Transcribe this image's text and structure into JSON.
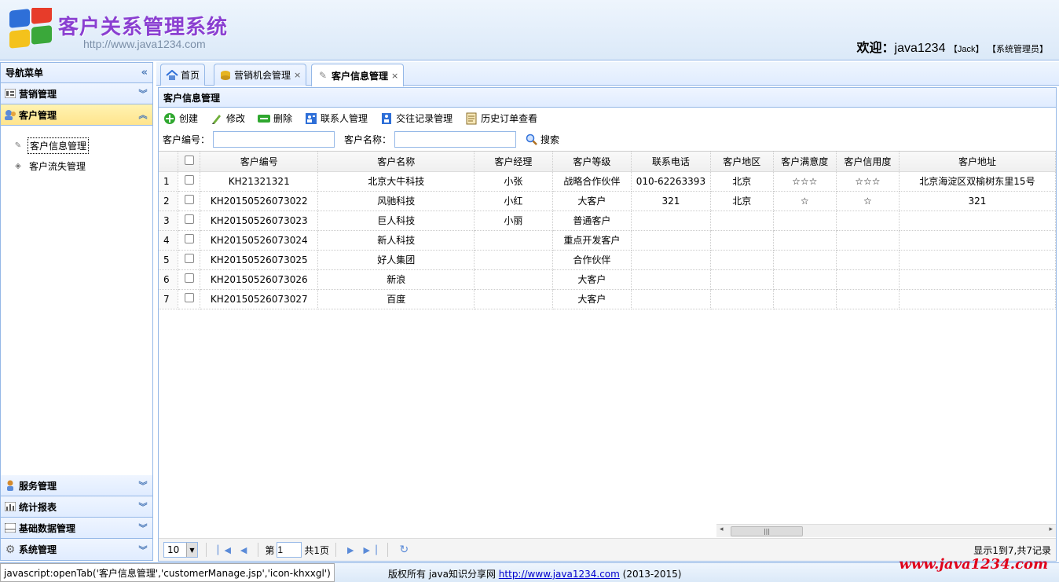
{
  "header": {
    "title": "客户关系管理系统",
    "url": "http://www.java1234.com",
    "welcome_label": "欢迎：",
    "username": "java1234",
    "nickname": "【Jack】",
    "role": "【系统管理员】"
  },
  "nav": {
    "title": "导航菜单",
    "items": [
      {
        "label": "营销管理"
      },
      {
        "label": "客户管理"
      },
      {
        "label": "服务管理"
      },
      {
        "label": "统计报表"
      },
      {
        "label": "基础数据管理"
      },
      {
        "label": "系统管理"
      }
    ],
    "sub_items": [
      {
        "label": "客户信息管理"
      },
      {
        "label": "客户流失管理"
      }
    ]
  },
  "tabs": [
    {
      "label": "首页"
    },
    {
      "label": "营销机会管理"
    },
    {
      "label": "客户信息管理"
    }
  ],
  "panel": {
    "title": "客户信息管理"
  },
  "toolbar": {
    "create": "创建",
    "edit": "修改",
    "delete": "删除",
    "contacts": "联系人管理",
    "records": "交往记录管理",
    "orders": "历史订单查看"
  },
  "search": {
    "code_label": "客户编号：",
    "name_label": "客户名称：",
    "button": "搜索"
  },
  "table": {
    "columns": [
      "客户编号",
      "客户名称",
      "客户经理",
      "客户等级",
      "联系电话",
      "客户地区",
      "客户满意度",
      "客户信用度",
      "客户地址"
    ],
    "rows": [
      [
        "1",
        "KH21321321",
        "北京大牛科技",
        "小张",
        "战略合作伙伴",
        "010-62263393",
        "北京",
        "☆☆☆",
        "☆☆☆",
        "北京海淀区双榆树东里15号"
      ],
      [
        "2",
        "KH20150526073022",
        "风驰科技",
        "小红",
        "大客户",
        "321",
        "北京",
        "☆",
        "☆",
        "321"
      ],
      [
        "3",
        "KH20150526073023",
        "巨人科技",
        "小丽",
        "普通客户",
        "",
        "",
        "",
        "",
        ""
      ],
      [
        "4",
        "KH20150526073024",
        "新人科技",
        "",
        "重点开发客户",
        "",
        "",
        "",
        "",
        ""
      ],
      [
        "5",
        "KH20150526073025",
        "好人集团",
        "",
        "合作伙伴",
        "",
        "",
        "",
        "",
        ""
      ],
      [
        "6",
        "KH20150526073026",
        "新浪",
        "",
        "大客户",
        "",
        "",
        "",
        "",
        ""
      ],
      [
        "7",
        "KH20150526073027",
        "百度",
        "",
        "大客户",
        "",
        "",
        "",
        "",
        ""
      ]
    ]
  },
  "pager": {
    "page_size": "10",
    "page_prefix": "第",
    "page_value": "1",
    "total_pages": "共1页",
    "info": "显示1到7,共7记录"
  },
  "footer": {
    "status": "javascript:openTab('客户信息管理','customerManage.jsp','icon-khxxgl')",
    "copyright_prefix": "版权所有 java知识分享网",
    "link": "http://www.java1234.com",
    "years": "(2013-2015)",
    "watermark": "www.java1234.com"
  },
  "colors": {
    "border": "#95b8e7",
    "accent": "#8a3fd1",
    "selected": "#ffe48d"
  }
}
